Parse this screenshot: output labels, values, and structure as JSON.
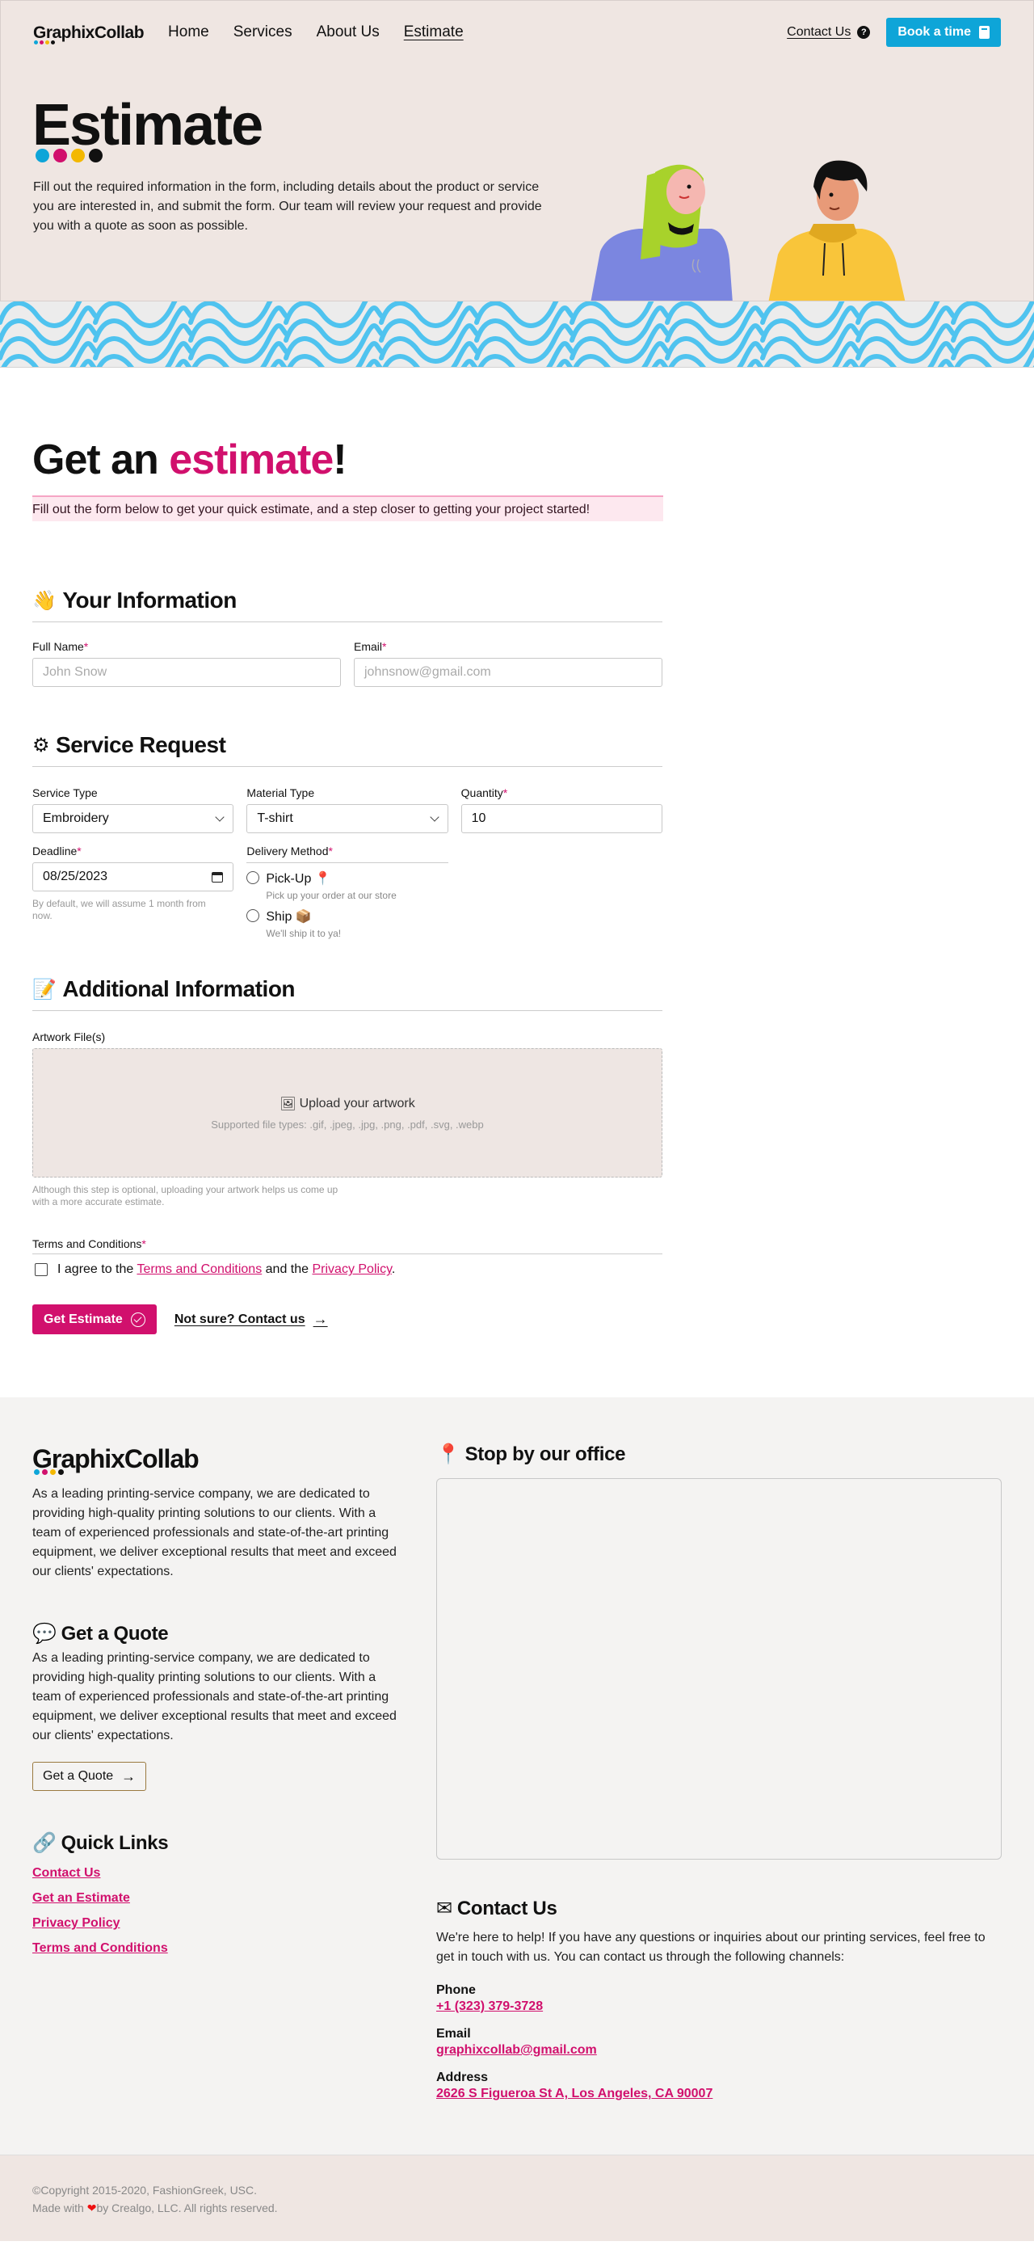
{
  "nav": {
    "logo": "GraphixCollab",
    "links": [
      "Home",
      "Services",
      "About Us",
      "Estimate"
    ],
    "contact_label": "Contact Us",
    "book_label": "Book a time"
  },
  "brand_colors": [
    "#0ea5d8",
    "#d1106d",
    "#f3b800",
    "#111111"
  ],
  "hero": {
    "title": "Estimate",
    "text": "Fill out the required information in the form, including details about the product or service you are interested in, and submit the form. Our team will review your request and provide you with a quote as soon as possible."
  },
  "form": {
    "title_pre": "Get an ",
    "title_pink": "estimate",
    "title_post": "!",
    "subtitle": "Fill out the form below to get your quick estimate, and a step closer to getting your project started!",
    "your_info": {
      "emoji": "👋",
      "heading": "Your Information",
      "full_name_label": "Full Name",
      "full_name_placeholder": "John Snow",
      "email_label": "Email",
      "email_placeholder": "johnsnow@gmail.com"
    },
    "service": {
      "emoji": "⚙",
      "heading": "Service Request",
      "service_type_label": "Service Type",
      "service_type_value": "Embroidery",
      "material_type_label": "Material Type",
      "material_type_value": "T-shirt",
      "quantity_label": "Quantity",
      "quantity_value": "10",
      "deadline_label": "Deadline",
      "deadline_value": "08/25/2023",
      "deadline_hint": "By default, we will assume 1 month from now.",
      "delivery_label": "Delivery Method",
      "pickup_label": "Pick-Up",
      "pickup_emoji": "📍",
      "pickup_sub": "Pick up your order at our store",
      "ship_label": "Ship",
      "ship_emoji": "📦",
      "ship_sub": "We'll ship it to ya!"
    },
    "additional": {
      "emoji": "📝",
      "heading": "Additional Information",
      "artwork_label": "Artwork File(s)",
      "upload_emoji": "🖼",
      "upload_title": "Upload your artwork",
      "upload_types": "Supported file types: .gif, .jpeg, .jpg, .png, .pdf, .svg, .webp",
      "upload_hint": "Although this step is optional, uploading your artwork helps us come up with a more accurate estimate."
    },
    "terms": {
      "label": "Terms and Conditions",
      "agree_pre": "I agree to the ",
      "terms_link": "Terms and Conditions",
      "and": " and the ",
      "privacy_link": "Privacy Policy",
      "period": "."
    },
    "submit_label": "Get Estimate",
    "not_sure_label": "Not sure? Contact us"
  },
  "footer": {
    "logo": "GraphixCollab",
    "about": "As a leading printing-service company, we are dedicated to providing high-quality printing solutions to our clients. With a team of experienced professionals and state-of-the-art printing equipment, we deliver exceptional results that meet and exceed our clients' expectations.",
    "quote_emoji": "💬",
    "quote_heading": "Get a Quote",
    "quote_text": "As a leading printing-service company, we are dedicated to providing high-quality printing solutions to our clients. With a team of experienced professionals and state-of-the-art printing equipment, we deliver exceptional results that meet and exceed our clients' expectations.",
    "quote_button": "Get a Quote",
    "links_emoji": "🔗",
    "links_heading": "Quick Links",
    "quick_links": [
      "Contact Us",
      "Get an Estimate",
      "Privacy Policy",
      "Terms and Conditions"
    ],
    "office_emoji": "📍",
    "office_heading": "Stop by our office",
    "contact_emoji": "✉",
    "contact_heading": "Contact Us",
    "contact_text": "We're here to help! If you have any questions or inquiries about our printing services, feel free to get in touch with us. You can contact us through the following channels:",
    "phone_label": "Phone",
    "phone_value": "+1 (323) 379-3728",
    "email_label": "Email",
    "email_value": "graphixcollab@gmail.com",
    "address_label": "Address",
    "address_value": "2626 S Figueroa St A, Los Angeles, CA 90007"
  },
  "copyright": {
    "line1": "©Copyright 2015-2020, FashionGreek, USC.",
    "line2_pre": "Made with ",
    "heart": "❤",
    "line2_post": "by Crealgo, LLC. All rights reserved."
  }
}
